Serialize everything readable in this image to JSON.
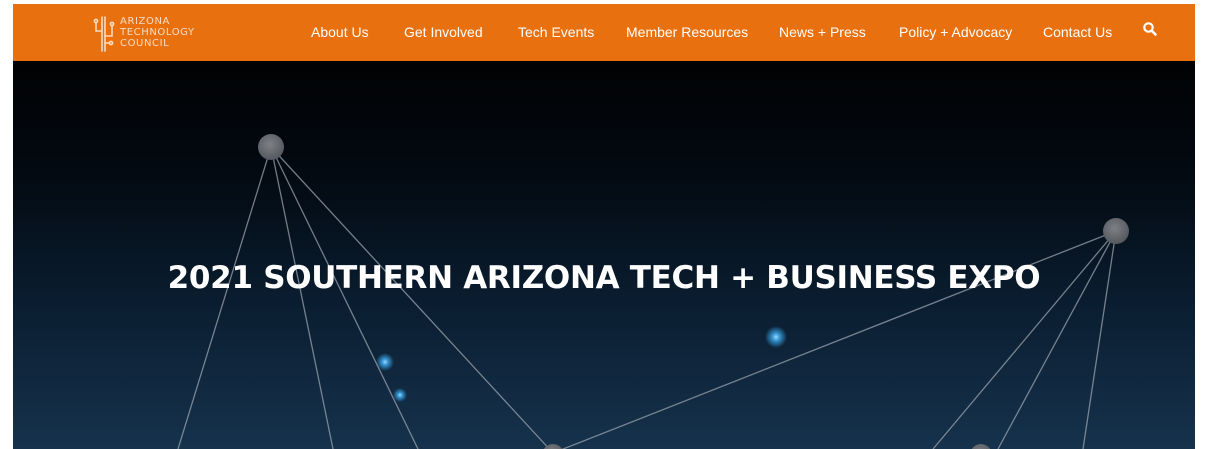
{
  "header": {
    "logo": {
      "lines": [
        "ARIZONA",
        "TECHNOLOGY",
        "COUNCIL"
      ],
      "icon": "cactus-circuit-icon"
    },
    "nav": [
      {
        "label": "About Us"
      },
      {
        "label": "Get Involved"
      },
      {
        "label": "Tech Events"
      },
      {
        "label": "Member Resources"
      },
      {
        "label": "News + Press"
      },
      {
        "label": "Policy + Advocacy"
      },
      {
        "label": "Contact Us"
      }
    ],
    "search_icon": "search-icon"
  },
  "hero": {
    "title": "2021 SOUTHERN ARIZONA TECH + BUSINESS EXPO",
    "background": "network-nodes-graphic"
  },
  "colors": {
    "nav_background": "#e8700f",
    "nav_text": "#ffffff",
    "hero_top": "#010203",
    "hero_bottom": "#16324c",
    "node_gray": "#6b6e73",
    "node_glow": "#3aa6e8",
    "title_text": "#ffffff"
  }
}
